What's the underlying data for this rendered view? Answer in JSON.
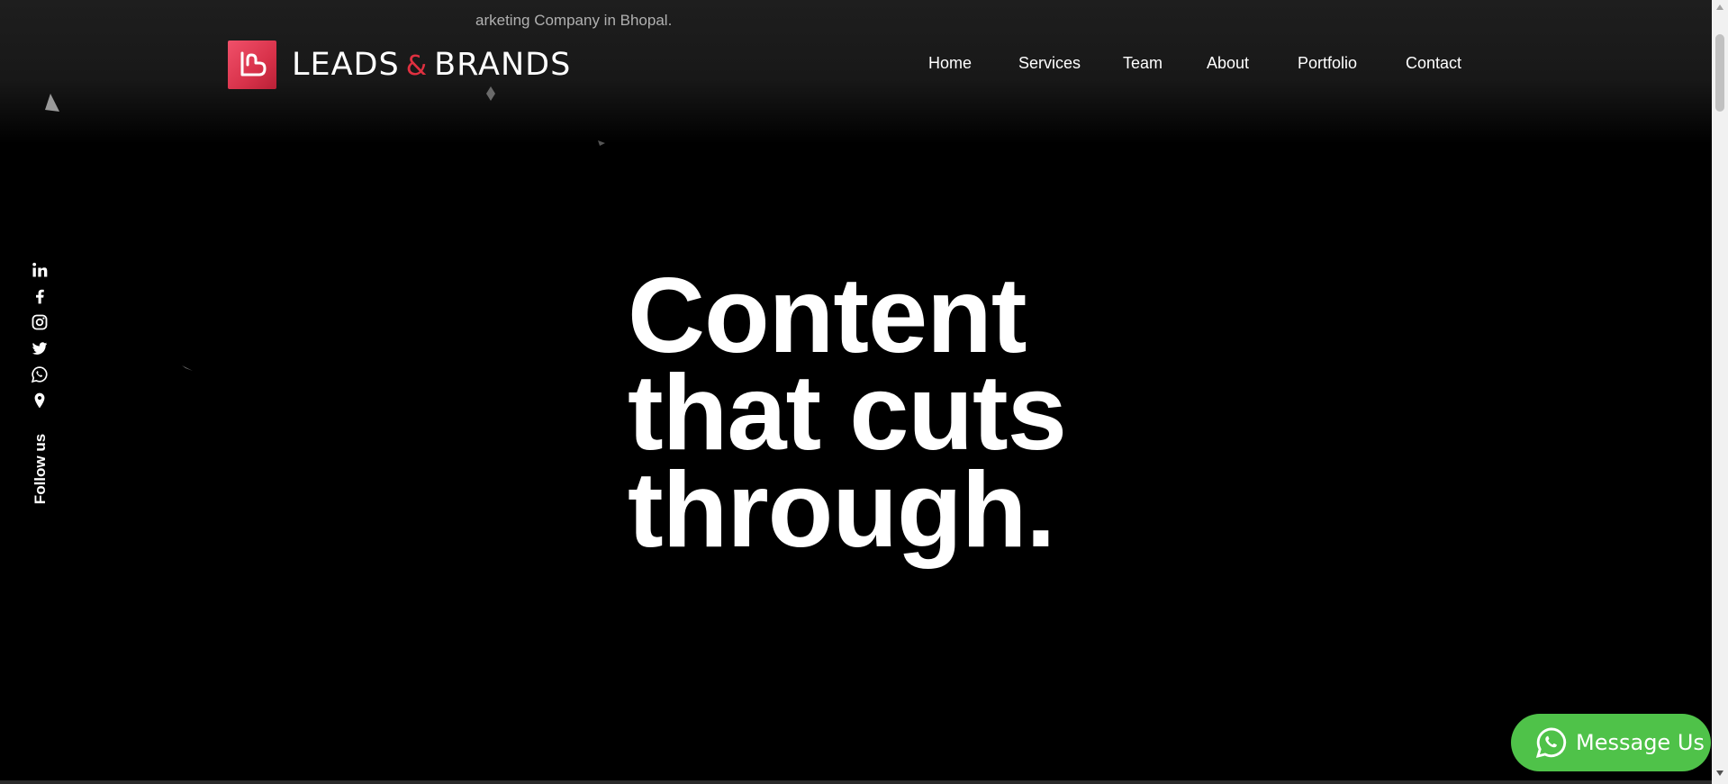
{
  "header": {
    "ticker_text": "arketing Company in Bhopal.",
    "logo": {
      "left_word": "LEADS",
      "amp": "&",
      "right_word": "BRANDS"
    }
  },
  "nav": {
    "items": [
      {
        "label": "Home"
      },
      {
        "label": "Services"
      },
      {
        "label": "Team"
      },
      {
        "label": "About"
      },
      {
        "label": "Portfolio"
      },
      {
        "label": "Contact"
      }
    ]
  },
  "social": {
    "icons": [
      "linkedin-icon",
      "facebook-icon",
      "instagram-icon",
      "twitter-icon",
      "whatsapp-icon",
      "location-pin-icon"
    ],
    "follow_label": "Follow us"
  },
  "hero": {
    "lines": [
      "Content",
      "that cuts",
      "through."
    ]
  },
  "whatsapp_button": {
    "label": "Message Us"
  },
  "colors": {
    "brand_red": "#e03040",
    "whatsapp_green": "#4fc249",
    "background": "#000000"
  }
}
